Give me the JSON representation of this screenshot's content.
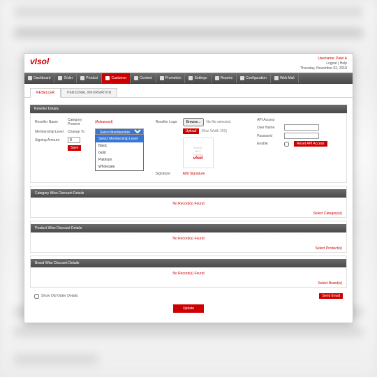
{
  "header": {
    "logo": "vIsol",
    "user": "Username: Patel A",
    "links": "Logout | Help",
    "date": "Thursday, November 02, 2018"
  },
  "nav": [
    {
      "label": "Dashboard"
    },
    {
      "label": "Order"
    },
    {
      "label": "Product"
    },
    {
      "label": "Customer"
    },
    {
      "label": "Content"
    },
    {
      "label": "Promotion"
    },
    {
      "label": "Settings"
    },
    {
      "label": "Reports"
    },
    {
      "label": "Configuration"
    },
    {
      "label": "Web Mail"
    }
  ],
  "tabs": {
    "t1": "RESELLER",
    "t2": "PERSONAL INFORMATION"
  },
  "form": {
    "section": "Reseller Details",
    "reseller_name_lbl": "Reseller Name",
    "membership_lbl": "Membership Level",
    "category_lbl": "Category Present",
    "category_val": "(Advanced)",
    "change_to_lbl": "Change To",
    "change_to_sel": "Select Membership Level",
    "signing_lbl": "Signing Amount",
    "signing_val": "0",
    "save": "Save",
    "dd": [
      "Select Membership Level",
      "Basic",
      "Gold",
      "Platinum",
      "Wholesale"
    ],
    "logo_lbl": "Reseller Logo",
    "browse": "Browse...",
    "nofile": "No file selected.",
    "upload": "Upload",
    "max": "(Max Width 250)",
    "img1": "IMAGE",
    "img2": "NOT",
    "img3": "FOUND",
    "imgv": "vIsol",
    "signature_lbl": "Signature",
    "add_sig": "Add Signature",
    "api_lbl": "API Access",
    "user_lbl": "User Name",
    "pass_lbl": "Password",
    "enable_lbl": "Enable",
    "reset_api": "Reset API Access"
  },
  "sections": {
    "cat": "Category Wise Discount Details",
    "prod": "Product Wise Discount Details",
    "brand": "Brand Wise Discount Details",
    "norec": "No Record(s) Found",
    "sel_cat": "Select Category(s)",
    "sel_prod": "Select Product(s)",
    "sel_brand": "Select Brand(s)"
  },
  "footer": {
    "chk": "Show Old Order Details",
    "send": "Send Email",
    "update": "Update"
  }
}
